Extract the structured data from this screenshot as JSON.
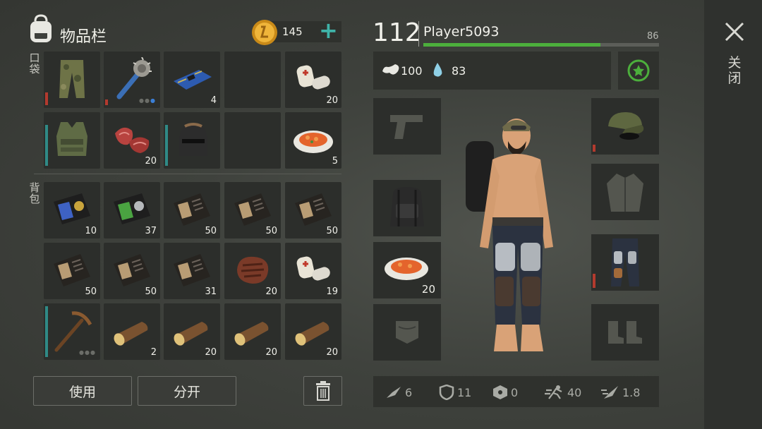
{
  "header": {
    "inventory_title": "物品栏",
    "coins": "145",
    "add_label": "+",
    "level": "112",
    "player_name": "Player5093",
    "xp_value": "86",
    "xp_fraction": 0.75
  },
  "sections": {
    "pockets_label": "口袋",
    "backpack_label": "背包"
  },
  "pockets": [
    {
      "name": "camo-pants",
      "count": ""
    },
    {
      "name": "spiked-mace",
      "count": ""
    },
    {
      "name": "circuit-board",
      "count": "4"
    },
    {
      "name": "empty",
      "count": ""
    },
    {
      "name": "bandage",
      "count": "20"
    },
    {
      "name": "camo-vest",
      "count": ""
    },
    {
      "name": "raw-meat",
      "count": "20"
    },
    {
      "name": "metal-helmet",
      "count": ""
    },
    {
      "name": "empty",
      "count": ""
    },
    {
      "name": "food-plate",
      "count": "5"
    }
  ],
  "backpack": [
    {
      "name": "blue-id-card",
      "count": "10"
    },
    {
      "name": "green-id-card",
      "count": "37"
    },
    {
      "name": "documents",
      "count": "50"
    },
    {
      "name": "documents",
      "count": "50"
    },
    {
      "name": "documents",
      "count": "50"
    },
    {
      "name": "documents",
      "count": "50"
    },
    {
      "name": "documents",
      "count": "50"
    },
    {
      "name": "documents",
      "count": "31"
    },
    {
      "name": "steak",
      "count": "20"
    },
    {
      "name": "bandage",
      "count": "19"
    },
    {
      "name": "pickaxe",
      "count": ""
    },
    {
      "name": "log",
      "count": "2"
    },
    {
      "name": "log",
      "count": "20"
    },
    {
      "name": "log",
      "count": "20"
    },
    {
      "name": "log",
      "count": "20"
    }
  ],
  "actions": {
    "use_label": "使用",
    "split_label": "分开"
  },
  "vitals": {
    "food": "100",
    "water": "83"
  },
  "equipment": {
    "food_count": "20"
  },
  "stats": {
    "attack": "6",
    "defense": "11",
    "radiation": "0",
    "speed": "40",
    "attack_speed": "1.8"
  },
  "close_label": "关闭",
  "colors": {
    "accent_teal": "#3fb3a8",
    "xp_green": "#4caf3c",
    "durability_red": "#b33a2e",
    "coin_gold": "#e0a526"
  }
}
